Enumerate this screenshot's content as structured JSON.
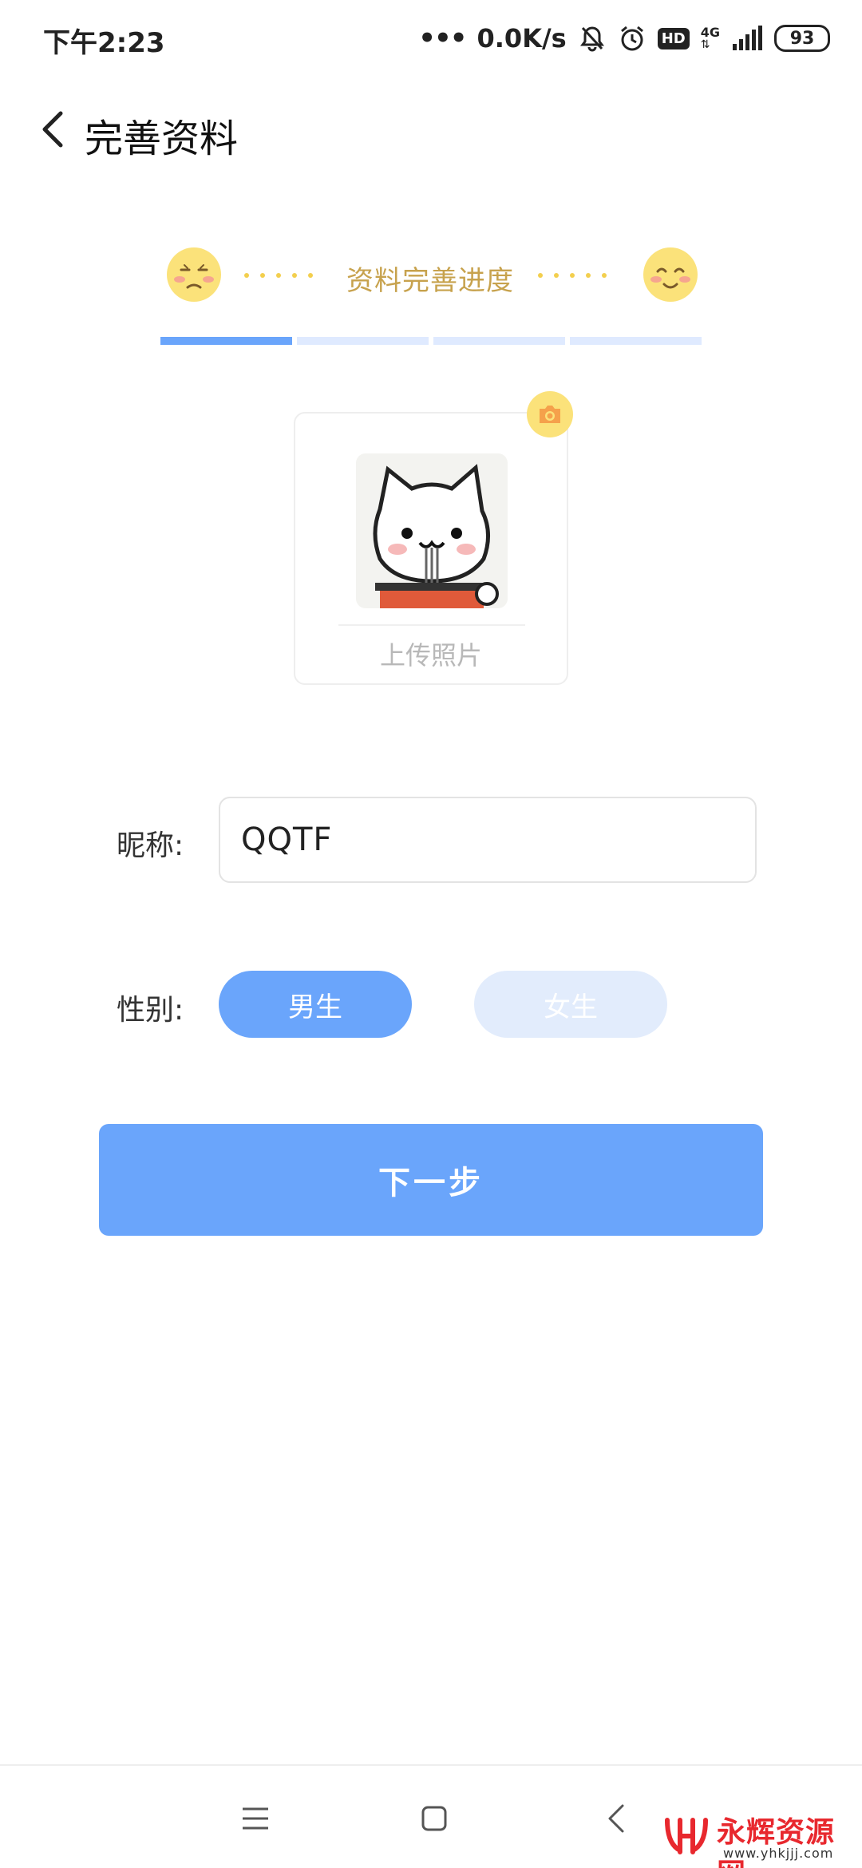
{
  "status_bar": {
    "time": "下午2:23",
    "dots": "•••",
    "speed": "0.0K/s",
    "hd": "HD",
    "network": "4G",
    "battery": "93",
    "icons": [
      "bell-muted-icon",
      "alarm-icon",
      "hd-icon",
      "signal-icon",
      "battery-icon"
    ]
  },
  "header": {
    "title": "完善资料",
    "back_icon": "chevron-left-icon"
  },
  "progress": {
    "label": "资料完善进度",
    "segments_total": 4,
    "segments_completed": 1,
    "accent": "#6aa5fb",
    "inactive": "#dfeaff",
    "face_color": "#fbe27a",
    "label_color": "#c7a24d"
  },
  "photo": {
    "upload_label": "上传照片",
    "camera_icon": "camera-icon"
  },
  "form": {
    "nickname_label": "昵称:",
    "nickname_value": "QQTF",
    "gender_label": "性别:",
    "gender_options": [
      "男生",
      "女生"
    ],
    "gender_selected": "男生"
  },
  "next_button": "下一步",
  "nav_bar": {
    "icons": [
      "menu-icon",
      "home-icon",
      "back-icon"
    ]
  },
  "watermark": {
    "title": "永辉资源网",
    "url": "www.yhkjjj.com",
    "color": "#e8282e"
  }
}
